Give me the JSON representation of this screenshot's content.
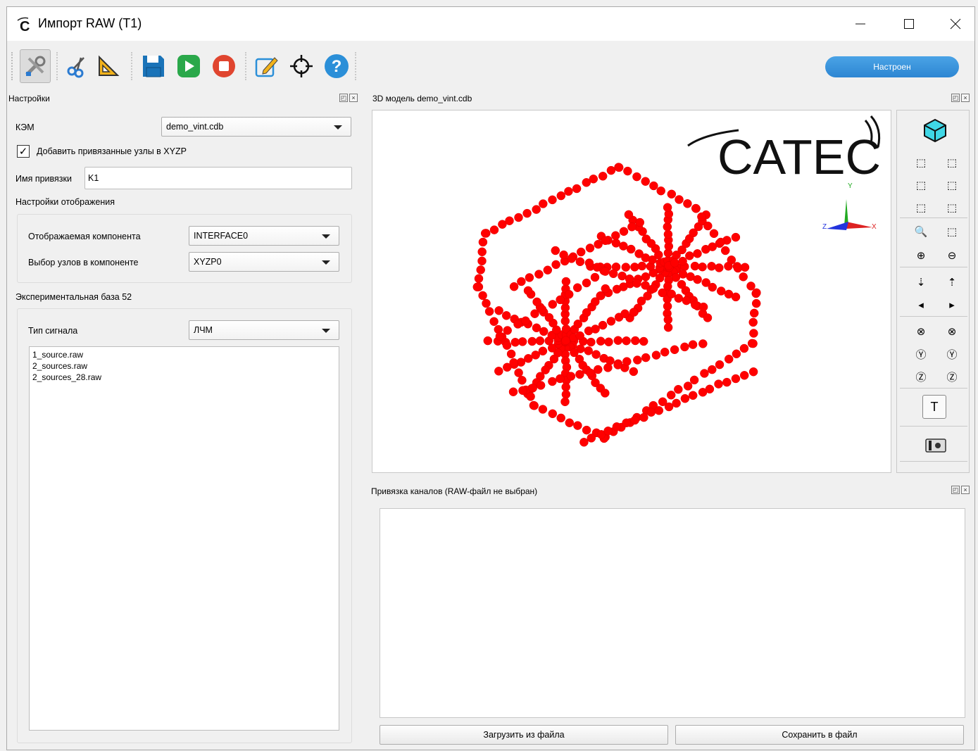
{
  "window": {
    "title": "Импорт RAW (T1)"
  },
  "toolbar": {
    "icons": [
      "settings-tools-icon",
      "scissors-icon",
      "ruler-triangle-icon",
      "save-icon",
      "play-icon",
      "stop-icon",
      "edit-icon",
      "target-icon",
      "help-icon"
    ],
    "status": "Настроен",
    "status_color": "#2d86d2"
  },
  "settings": {
    "title": "Настройки",
    "kem_label": "КЭМ",
    "kem_value": "demo_vint.cdb",
    "add_nodes_label": "Добавить привязанные узлы в XYZP",
    "add_nodes_checked": true,
    "binding_name_label": "Имя привязки",
    "binding_name_value": "K1",
    "display_settings_label": "Настройки отображения",
    "component_label": "Отображаемая компонента",
    "component_value": "INTERFACE0",
    "node_select_label": "Выбор узлов в компоненте",
    "node_select_value": "XYZP0",
    "exp_base_label": "Экспериментальная база 52",
    "signal_type_label": "Тип сигнала",
    "signal_type_value": "ЛЧМ",
    "files": [
      "1_source.raw",
      "2_sources.raw",
      "2_sources_28.raw"
    ]
  },
  "model": {
    "title": "3D модель demo_vint.cdb",
    "logo": "CATEC",
    "point_color": "#ff0000",
    "axis_labels": {
      "x": "X",
      "y": "Y",
      "z": "Z"
    }
  },
  "channels": {
    "title": "Привязка каналов (RAW-файл не выбран)",
    "load_button": "Загрузить из файла",
    "save_button": "Сохранить в файл"
  }
}
